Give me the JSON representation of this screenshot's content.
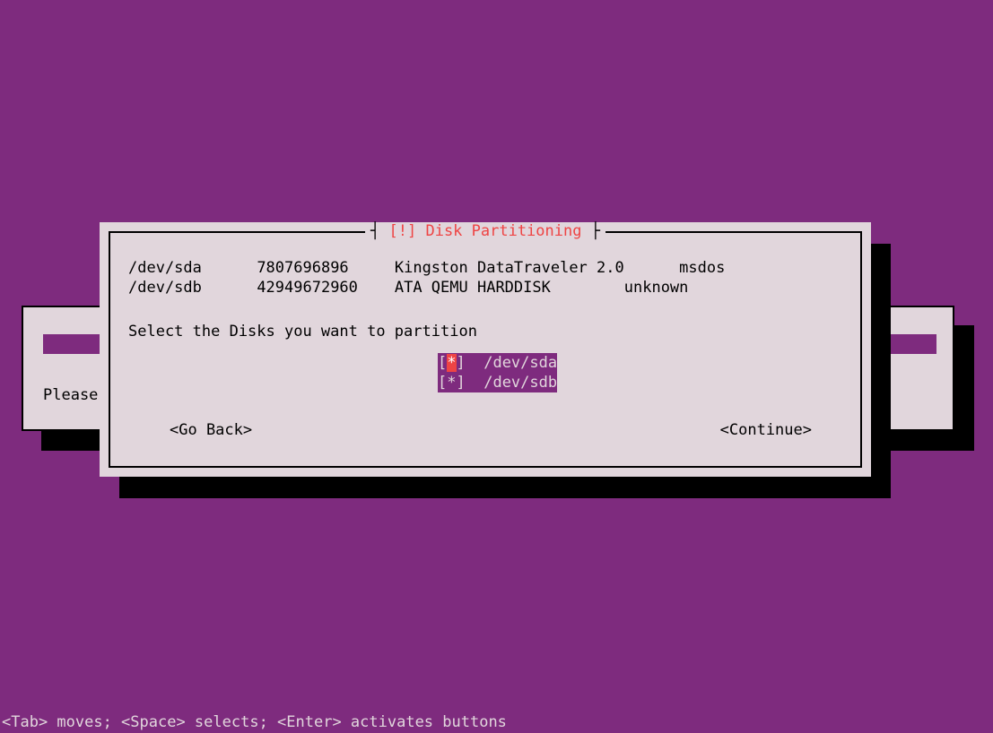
{
  "dialog": {
    "title": "[!] Disk Partitioning",
    "disks": [
      {
        "device": "/dev/sda",
        "size": "7807696896",
        "model": "Kingston DataTraveler 2.0",
        "label": "msdos"
      },
      {
        "device": "/dev/sdb",
        "size": "42949672960",
        "model": "ATA QEMU HARDDISK",
        "label": "unknown"
      }
    ],
    "prompt": "Select the Disks you want to partition",
    "options": [
      {
        "mark": "*",
        "text": "/dev/sda",
        "focused": true
      },
      {
        "mark": "*",
        "text": "/dev/sdb",
        "focused": false
      }
    ],
    "go_back": "<Go Back>",
    "continue": "<Continue>"
  },
  "background_dialog": {
    "please": "Please"
  },
  "help_bar": "<Tab> moves; <Space> selects; <Enter> activates buttons"
}
